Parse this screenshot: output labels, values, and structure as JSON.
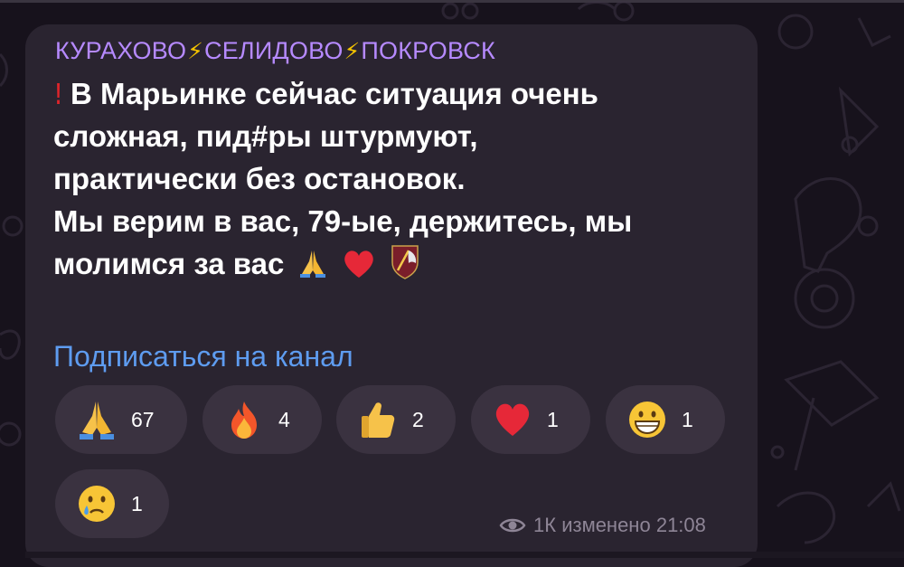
{
  "channel": {
    "title_parts": [
      "КУРАХОВО",
      "СЕЛИДОВО",
      "ПОКРОВСК"
    ],
    "separator_icon": "lightning-icon",
    "title_color": "#b68aff"
  },
  "message": {
    "lines": [
      "В Марьинке сейчас ситуация очень",
      "сложная, пид#ры штурмуют,",
      "практически без остановок.",
      "Мы верим в вас, 79-ые, держитесь, мы",
      "молимся за вас"
    ],
    "leading_icon": "exclamation-icon",
    "trailing_icons": [
      "praying-hands-icon",
      "red-heart-icon",
      "brigade-emblem-icon"
    ]
  },
  "subscribe_link": "Подписаться на канал",
  "reactions": [
    {
      "icon": "praying-hands-icon",
      "count": "67"
    },
    {
      "icon": "fire-icon",
      "count": "4"
    },
    {
      "icon": "thumbs-up-icon",
      "count": "2"
    },
    {
      "icon": "red-heart-icon",
      "count": "1"
    },
    {
      "icon": "grinning-face-icon",
      "count": "1"
    },
    {
      "icon": "crying-face-icon",
      "count": "1"
    }
  ],
  "footer": {
    "views": "1К",
    "edited_label": "изменено",
    "time": "21:08"
  },
  "colors": {
    "bubble": "#2a2430",
    "link": "#5e9cf0",
    "reaction_bg": "#3a3240",
    "meta": "#8e8596"
  }
}
